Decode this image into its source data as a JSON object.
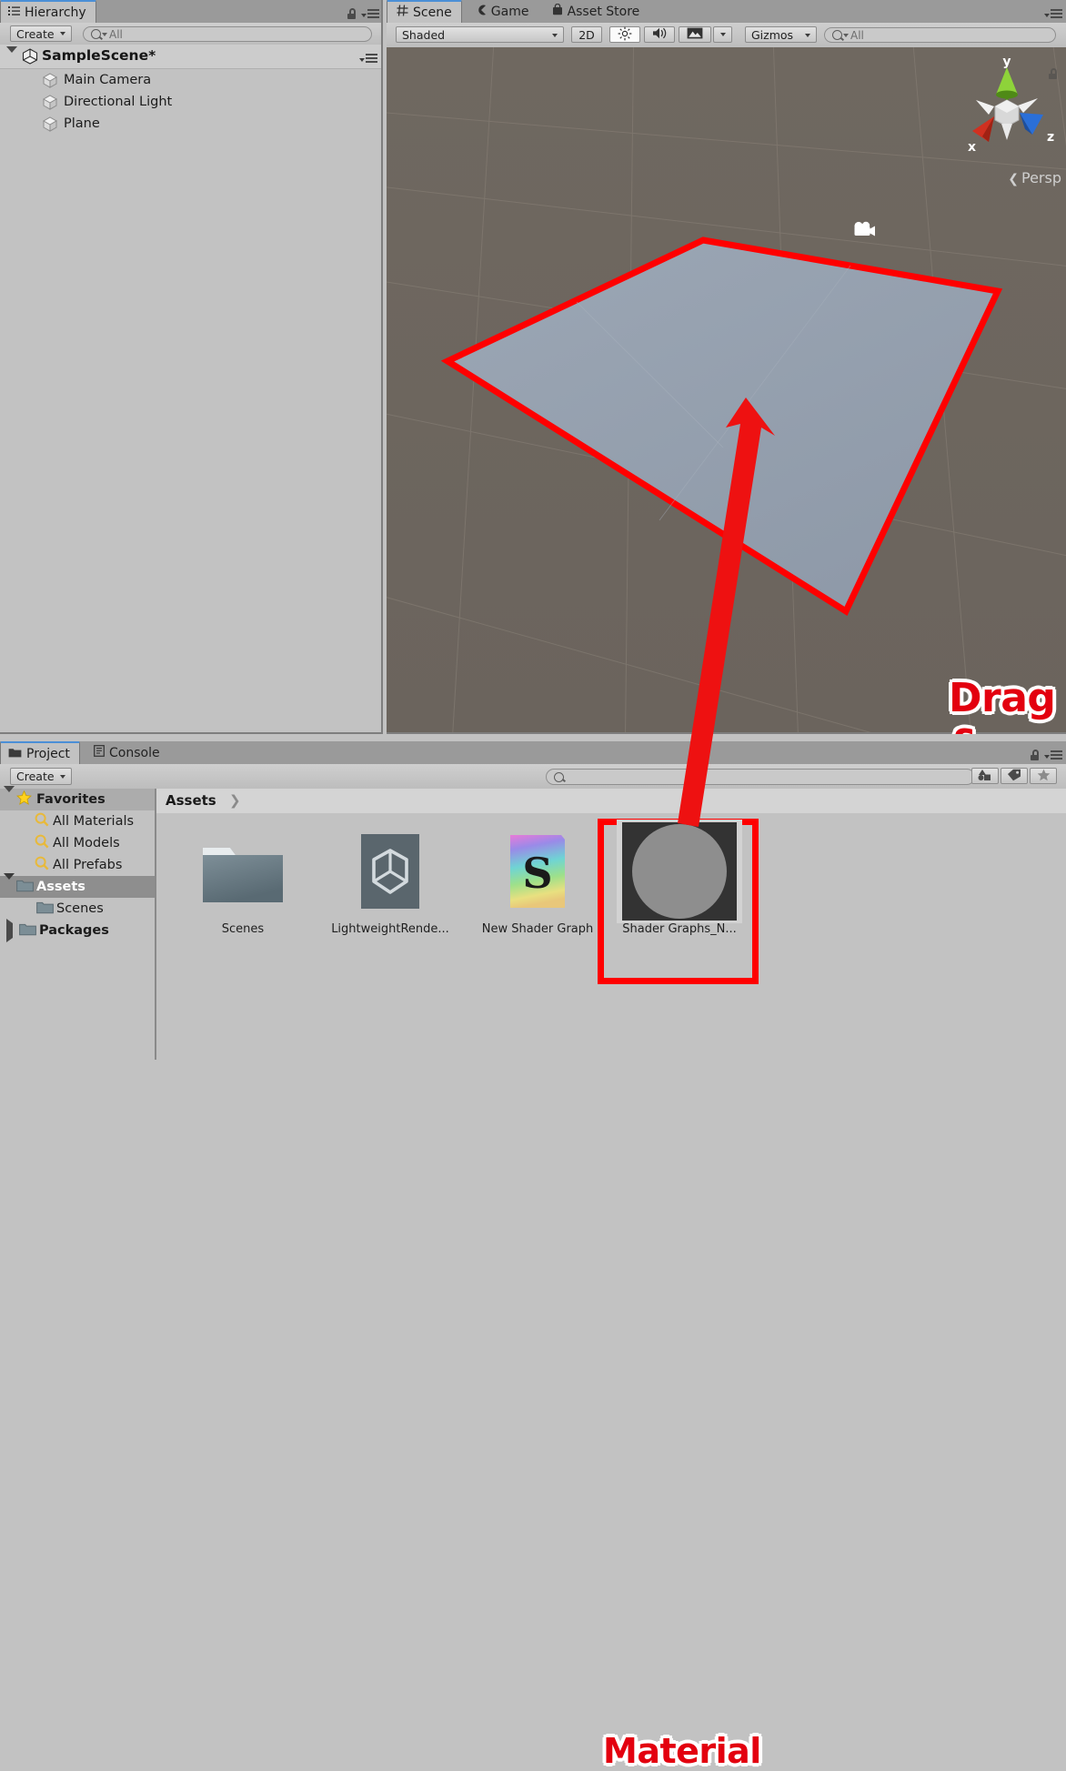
{
  "hierarchy": {
    "tab_label": "Hierarchy",
    "tab_icon": "hierarchy-list-icon",
    "lock_icon": "lock-icon",
    "menu_icon": "panel-menu-icon",
    "create_label": "Create",
    "search_placeholder": "All",
    "search_value": "",
    "scene_root": "SampleScene*",
    "items": [
      {
        "label": "Main Camera",
        "icon": "gameobject-cube-icon"
      },
      {
        "label": "Directional Light",
        "icon": "gameobject-cube-icon"
      },
      {
        "label": "Plane",
        "icon": "gameobject-cube-icon"
      }
    ]
  },
  "scene": {
    "tabs": [
      {
        "label": "Scene",
        "icon": "scene-grid-icon",
        "active": true
      },
      {
        "label": "Game",
        "icon": "game-pacman-icon",
        "active": false
      },
      {
        "label": "Asset Store",
        "icon": "asset-store-icon",
        "active": false
      }
    ],
    "menu_icon": "panel-menu-icon",
    "toolbar": {
      "draw_mode": "Shaded",
      "two_d_label": "2D",
      "lighting_icon": "sun-lighting-icon",
      "lighting_on": true,
      "audio_icon": "speaker-audio-icon",
      "fx_icon": "image-effects-icon",
      "gizmos_label": "Gizmos",
      "search_placeholder": "All",
      "search_value": ""
    },
    "gizmo": {
      "axis_x": "x",
      "axis_y": "y",
      "axis_z": "z",
      "projection_label": "Persp",
      "color_x": "#d03020",
      "color_y": "#7ed01e",
      "color_z": "#2a6fd8",
      "lock_icon": "lock-icon"
    },
    "objects": {
      "camera_gizmo_icon": "camera-gizmo-icon",
      "light_gizmo_icon": "directional-light-gizmo-icon",
      "plane_fill_color": "#95a0b0",
      "selection_outline_color": "#ff0000"
    },
    "background_color": "#6e6760"
  },
  "project": {
    "tabs": [
      {
        "label": "Project",
        "icon": "folder-icon",
        "active": true
      },
      {
        "label": "Console",
        "icon": "console-icon",
        "active": false
      }
    ],
    "lock_icon": "lock-icon",
    "menu_icon": "panel-menu-icon",
    "create_label": "Create",
    "search_placeholder": "",
    "search_value": "",
    "filter_icons": [
      "filter-by-type-icon",
      "filter-by-label-icon",
      "filter-favorites-icon"
    ],
    "breadcrumb": "Assets",
    "tree": [
      {
        "label": "Favorites",
        "icon": "star-icon",
        "depth": 0,
        "expanded": true,
        "selected": false
      },
      {
        "label": "All Materials",
        "icon": "search-magnifier-icon",
        "depth": 1,
        "selected": false
      },
      {
        "label": "All Models",
        "icon": "search-magnifier-icon",
        "depth": 1,
        "selected": false
      },
      {
        "label": "All Prefabs",
        "icon": "search-magnifier-icon",
        "depth": 1,
        "selected": false
      },
      {
        "label": "Assets",
        "icon": "folder-icon",
        "depth": 0,
        "expanded": true,
        "selected": true
      },
      {
        "label": "Scenes",
        "icon": "folder-icon",
        "depth": 1,
        "selected": false
      },
      {
        "label": "Packages",
        "icon": "folder-icon",
        "depth": 0,
        "expanded": false,
        "selected": false
      }
    ],
    "assets": [
      {
        "label": "Scenes",
        "icon": "folder-asset-icon",
        "selected": false
      },
      {
        "label": "LightweightRende...",
        "icon": "unity-asset-icon",
        "selected": false
      },
      {
        "label": "New Shader Graph",
        "icon": "shader-graph-icon",
        "selected": false
      },
      {
        "label": "Shader Graphs_N...",
        "icon": "material-sphere-icon",
        "selected": true
      }
    ]
  },
  "annotations": {
    "drag_drop": "Drag & Drop",
    "material": "Material",
    "color": "#e3000f",
    "arrow_icon": "red-arrow-icon",
    "highlight_box_icon": "red-highlight-box"
  }
}
